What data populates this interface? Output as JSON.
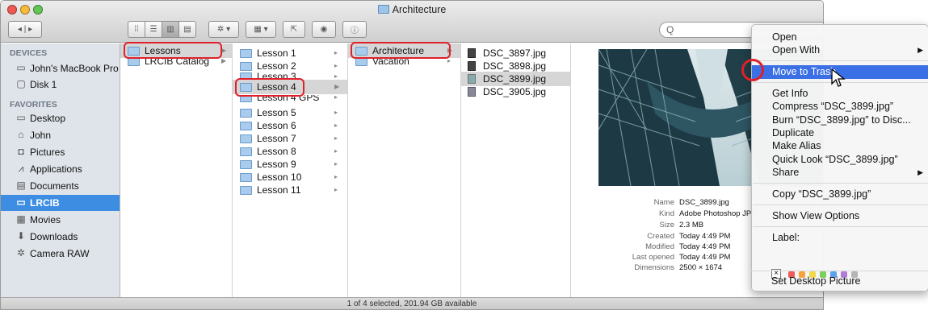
{
  "window": {
    "title": "Architecture"
  },
  "toolbar": {
    "search_placeholder": "Q"
  },
  "sidebar": {
    "devices_header": "DEVICES",
    "devices": [
      {
        "label": "John's MacBook Pro",
        "icon": "laptop-icon"
      },
      {
        "label": "Disk 1",
        "icon": "disk-icon"
      }
    ],
    "favorites_header": "FAVORITES",
    "favorites": [
      {
        "label": "Desktop",
        "icon": "desktop-icon"
      },
      {
        "label": "John",
        "icon": "home-icon"
      },
      {
        "label": "Pictures",
        "icon": "camera-icon"
      },
      {
        "label": "Applications",
        "icon": "applications-icon"
      },
      {
        "label": "Documents",
        "icon": "documents-icon"
      },
      {
        "label": "LRCIB",
        "icon": "folder-icon"
      },
      {
        "label": "Movies",
        "icon": "movies-icon"
      },
      {
        "label": "Downloads",
        "icon": "downloads-icon"
      },
      {
        "label": "Camera RAW",
        "icon": "gear-icon"
      }
    ]
  },
  "columns": {
    "col1": [
      "Lessons",
      "LRCIB Catalog"
    ],
    "col2": [
      "Lesson 1",
      "Lesson 2",
      "Lesson 3",
      "Lesson 4",
      "Lesson 4 GPS",
      "Lesson 5",
      "Lesson 6",
      "Lesson 7",
      "Lesson 8",
      "Lesson 9",
      "Lesson 10",
      "Lesson 11"
    ],
    "col3": [
      "Architecture",
      "Vacation"
    ],
    "col4": [
      "DSC_3897.jpg",
      "DSC_3898.jpg",
      "DSC_3899.jpg",
      "DSC_3905.jpg"
    ]
  },
  "info": {
    "name_label": "Name",
    "name": "DSC_3899.jpg",
    "kind_label": "Kind",
    "kind": "Adobe Photoshop JPE",
    "size_label": "Size",
    "size": "2.3 MB",
    "created_label": "Created",
    "created": "Today 4:49 PM",
    "modified_label": "Modified",
    "modified": "Today 4:49 PM",
    "opened_label": "Last opened",
    "opened": "Today 4:49 PM",
    "dimensions_label": "Dimensions",
    "dimensions": "2500 × 1674"
  },
  "status": "1 of 4 selected, 201.94 GB available",
  "context_menu": {
    "open": "Open",
    "open_with": "Open With",
    "move_to_trash": "Move to Trash",
    "get_info": "Get Info",
    "compress": "Compress “DSC_3899.jpg”",
    "burn": "Burn “DSC_3899.jpg” to Disc...",
    "duplicate": "Duplicate",
    "make_alias": "Make Alias",
    "quick_look": "Quick Look “DSC_3899.jpg”",
    "share": "Share",
    "copy": "Copy “DSC_3899.jpg”",
    "show_view_options": "Show View Options",
    "label": "Label:",
    "label_none": "×",
    "set_desktop_picture": "Set Desktop Picture"
  },
  "label_colors": [
    "#f05a5a",
    "#f5a33c",
    "#f2d94a",
    "#7ccf58",
    "#5aa3ec",
    "#b07cd6",
    "#b5b5b5"
  ],
  "accent": "#3b6fe6"
}
